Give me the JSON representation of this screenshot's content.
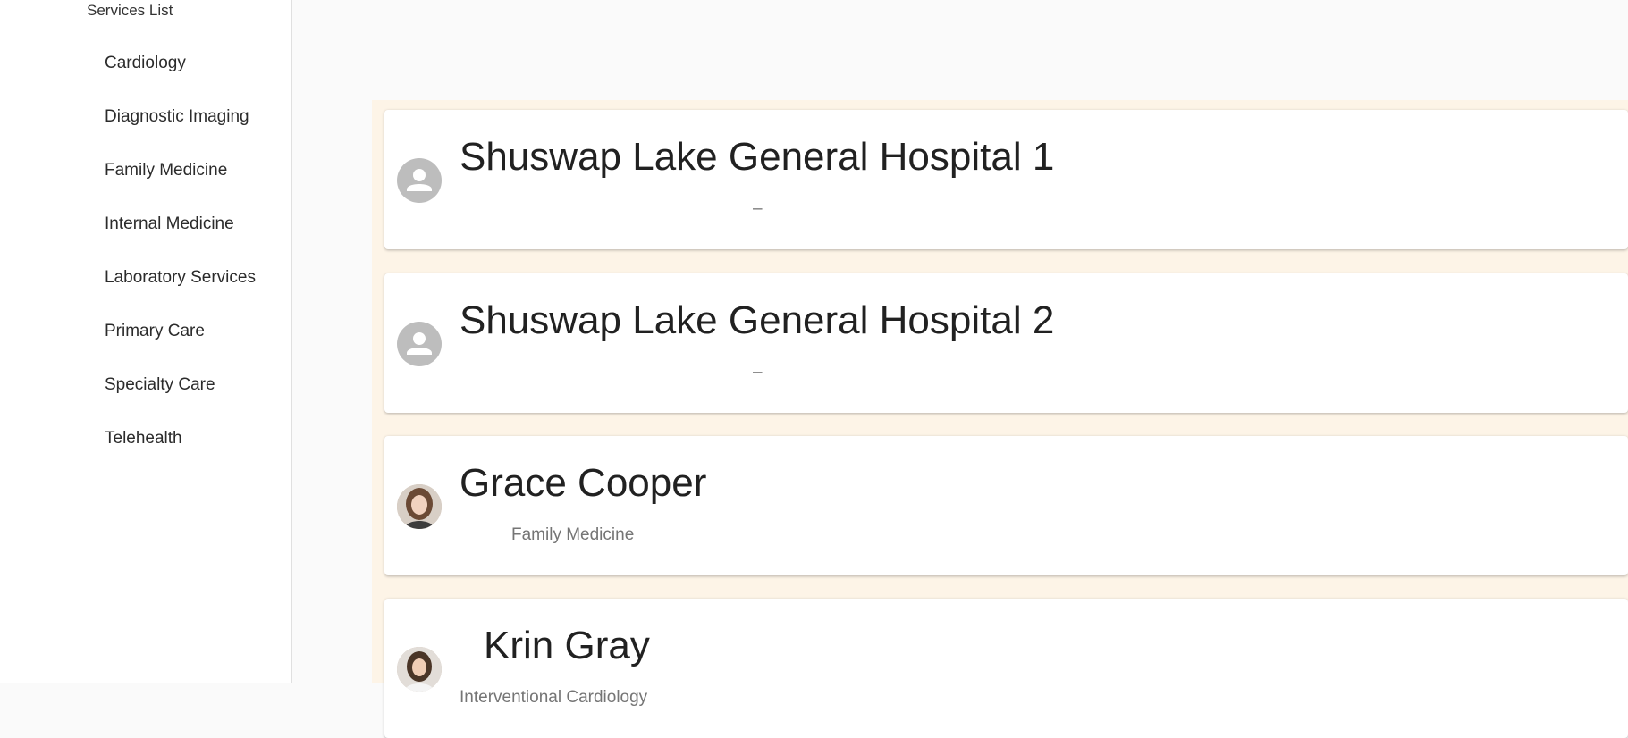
{
  "sidebar": {
    "subheader": "Services List",
    "items": [
      {
        "label": "Cardiology"
      },
      {
        "label": "Diagnostic Imaging"
      },
      {
        "label": "Family Medicine"
      },
      {
        "label": "Internal Medicine"
      },
      {
        "label": "Laboratory Services"
      },
      {
        "label": "Primary Care"
      },
      {
        "label": "Specialty Care"
      },
      {
        "label": "Telehealth"
      }
    ]
  },
  "cards": [
    {
      "title": "Shuswap Lake General Hospital 1",
      "subtitle": "–",
      "avatar": "person-icon"
    },
    {
      "title": "Shuswap Lake General Hospital 2",
      "subtitle": "–",
      "avatar": "person-icon"
    },
    {
      "title": "Grace Cooper",
      "subtitle": "Family Medicine",
      "avatar": "profile-photo"
    },
    {
      "title": "Krin Gray",
      "subtitle": "Interventional Cardiology",
      "avatar": "profile-photo"
    }
  ],
  "colors": {
    "panel_background": "#fdf4e7",
    "avatar_placeholder": "#bdbdbd"
  }
}
